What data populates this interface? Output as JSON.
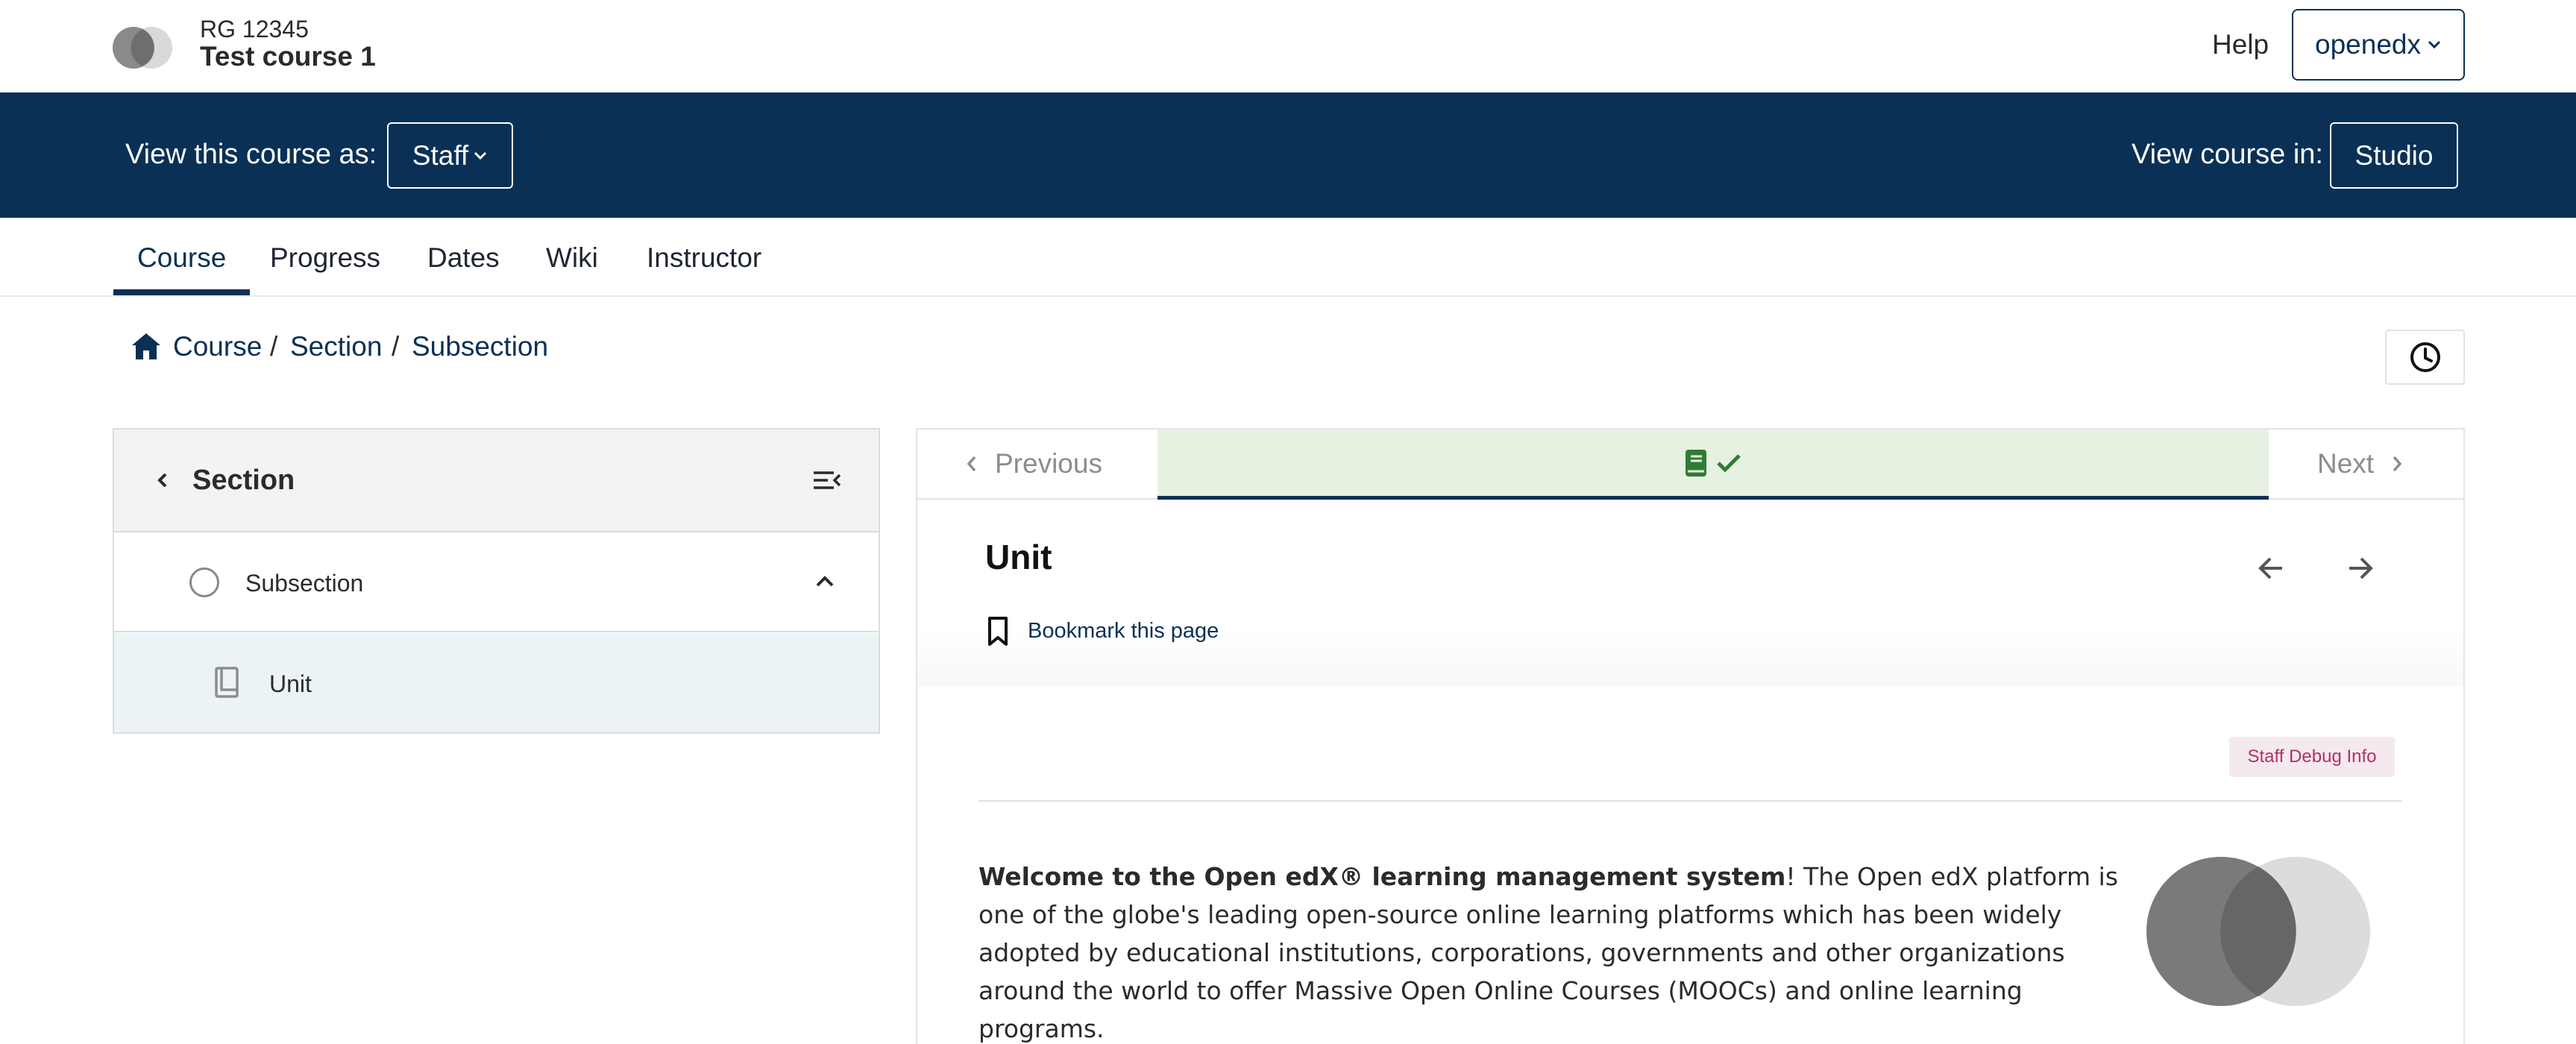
{
  "header": {
    "course_org": "RG 12345",
    "course_title": "Test course 1",
    "help_label": "Help",
    "user_menu_label": "openedx"
  },
  "masquerade": {
    "view_as_label": "View this course as:",
    "view_as_value": "Staff",
    "view_in_label": "View course in:",
    "studio_label": "Studio"
  },
  "tabs": [
    {
      "label": "Course",
      "active": true
    },
    {
      "label": "Progress"
    },
    {
      "label": "Dates"
    },
    {
      "label": "Wiki"
    },
    {
      "label": "Instructor"
    }
  ],
  "breadcrumb": [
    "Course",
    "Section",
    "Subsection"
  ],
  "sidebar": {
    "title": "Section",
    "subsection_label": "Subsection",
    "unit_label": "Unit"
  },
  "sequence": {
    "previous_label": "Previous",
    "next_label": "Next"
  },
  "unit": {
    "title": "Unit",
    "bookmark_label": "Bookmark this page",
    "debug_label": "Staff Debug Info",
    "welcome_bold": "Welcome to the Open edX®  learning management system",
    "welcome_text": "! The Open edX platform is one of the globe's leading open-source online learning platforms which has been widely adopted by educational institutions, corporations, governments and other organizations around the world to offer Massive Open Online Courses (MOOCs) and online learning programs."
  },
  "colors": {
    "primary": "#0a3055",
    "success": "#2f7d32",
    "active_unit_bg": "#e7f1e2",
    "debug": "#b0306a"
  },
  "icons": [
    "logo-icon",
    "chevron-down-icon",
    "home-icon",
    "clock-icon",
    "chevron-left-icon",
    "sidebar-close-icon",
    "circle-icon",
    "chevron-up-icon",
    "book-icon",
    "check-icon",
    "chevron-right-icon",
    "arrow-left-icon",
    "arrow-right-icon",
    "bookmark-icon"
  ]
}
